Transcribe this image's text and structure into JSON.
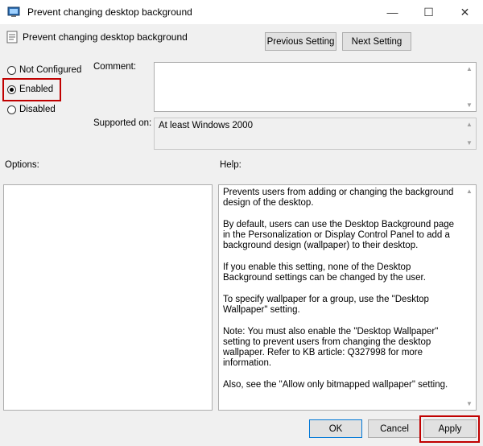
{
  "window": {
    "title": "Prevent changing desktop background",
    "controls": {
      "minimize": "—",
      "maximize": "☐",
      "close": "✕"
    }
  },
  "header": {
    "policy_name": "Prevent changing desktop background",
    "previous_label": "Previous Setting",
    "next_label": "Next Setting"
  },
  "state": {
    "not_configured_label": "Not Configured",
    "enabled_label": "Enabled",
    "disabled_label": "Disabled",
    "selected": "enabled"
  },
  "comment": {
    "label": "Comment:",
    "value": ""
  },
  "supported": {
    "label": "Supported on:",
    "value": "At least Windows 2000"
  },
  "options": {
    "label": "Options:"
  },
  "help": {
    "label": "Help:",
    "paragraphs": [
      "Prevents users from adding or changing the background design of the desktop.",
      "By default, users can use the Desktop Background page in the Personalization or Display Control Panel to add a background design (wallpaper) to their desktop.",
      "If you enable this setting, none of the Desktop Background settings can be changed by the user.",
      "To specify wallpaper for a group, use the \"Desktop Wallpaper\" setting.",
      "Note: You must also enable the \"Desktop Wallpaper\" setting to prevent users from changing the desktop wallpaper. Refer to KB article: Q327998 for more information.",
      "Also, see the \"Allow only bitmapped wallpaper\" setting."
    ]
  },
  "footer": {
    "ok_label": "OK",
    "cancel_label": "Cancel",
    "apply_label": "Apply"
  },
  "colors": {
    "highlight": "#c00000",
    "background": "#f0f0f0",
    "accent": "#0078d7"
  },
  "icons": {
    "app": "policy-editor-icon",
    "policy": "policy-setting-icon"
  }
}
